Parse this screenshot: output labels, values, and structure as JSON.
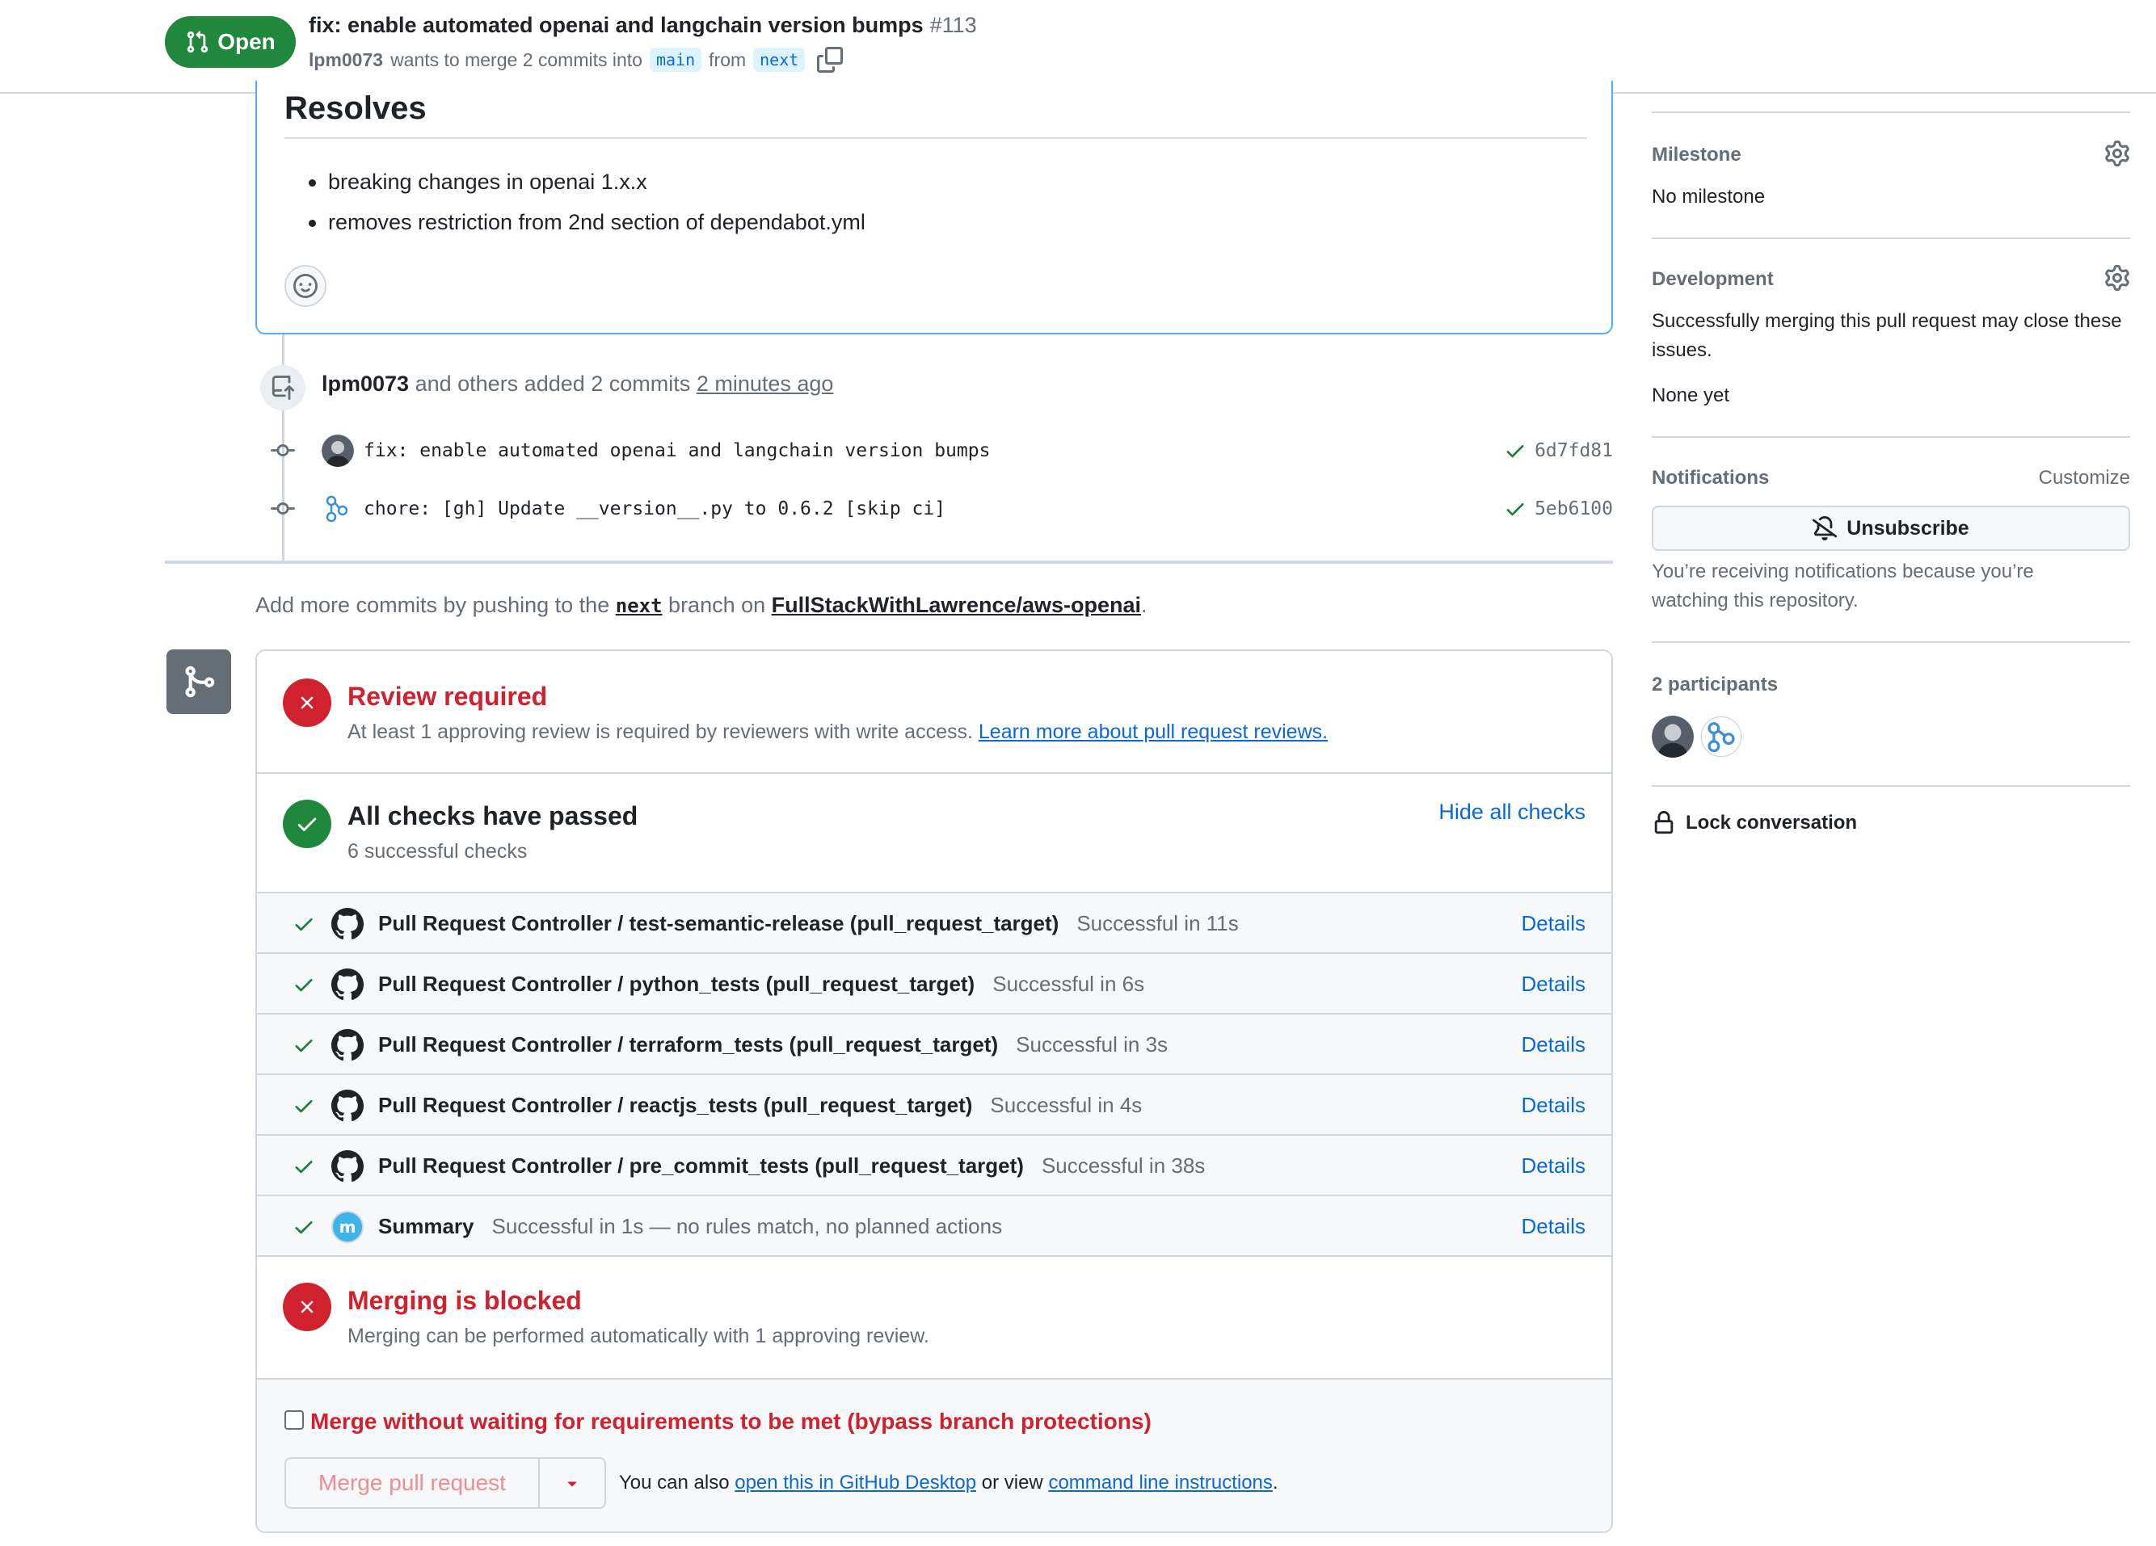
{
  "header": {
    "state": "Open",
    "title": "fix: enable automated openai and langchain version bumps",
    "number": "#113",
    "author": "lpm0073",
    "merge_text_1": "wants to merge 2 commits into",
    "base_branch": "main",
    "merge_text_2": "from",
    "head_branch": "next"
  },
  "description": {
    "heading": "Resolves",
    "items": [
      "breaking changes in openai 1.x.x",
      "removes restriction from 2nd section of dependabot.yml"
    ]
  },
  "timeline": {
    "author": "lpm0073",
    "summary": "and others added 2 commits",
    "time": "2 minutes ago",
    "commits": [
      {
        "message": "fix: enable automated openai and langchain version bumps",
        "sha": "6d7fd81"
      },
      {
        "message": "chore: [gh] Update __version__.py to 0.6.2 [skip ci]",
        "sha": "5eb6100"
      }
    ]
  },
  "push_hint": {
    "prefix": "Add more commits by pushing to the",
    "branch": "next",
    "middle": "branch on",
    "repo": "FullStackWithLawrence/aws-openai",
    "suffix": "."
  },
  "merge_box": {
    "review": {
      "title": "Review required",
      "text": "At least 1 approving review is required by reviewers with write access.",
      "link": "Learn more about pull request reviews."
    },
    "checks": {
      "title": "All checks have passed",
      "subtitle": "6 successful checks",
      "toggle": "Hide all checks",
      "details_label": "Details",
      "items": [
        {
          "name": "Pull Request Controller / test-semantic-release (pull_request_target)",
          "status": "Successful in 11s"
        },
        {
          "name": "Pull Request Controller / python_tests (pull_request_target)",
          "status": "Successful in 6s"
        },
        {
          "name": "Pull Request Controller / terraform_tests (pull_request_target)",
          "status": "Successful in 3s"
        },
        {
          "name": "Pull Request Controller / reactjs_tests (pull_request_target)",
          "status": "Successful in 4s"
        },
        {
          "name": "Pull Request Controller / pre_commit_tests (pull_request_target)",
          "status": "Successful in 38s"
        },
        {
          "name": "Summary",
          "status": "Successful in 1s — no rules match, no planned actions"
        }
      ]
    },
    "blocked": {
      "title": "Merging is blocked",
      "text": "Merging can be performed automatically with 1 approving review."
    },
    "bypass_label": "Merge without waiting for requirements to be met (bypass branch protections)",
    "merge_button": "Merge pull request",
    "hint_prefix": "You can also",
    "hint_link_1": "open this in GitHub Desktop",
    "hint_middle": "or view",
    "hint_link_2": "command line instructions",
    "hint_suffix": "."
  },
  "sidebar": {
    "milestone_heading": "Milestone",
    "milestone_value": "No milestone",
    "development_heading": "Development",
    "development_text": "Successfully merging this pull request may close these issues.",
    "development_value": "None yet",
    "notifications_heading": "Notifications",
    "customize": "Customize",
    "unsubscribe": "Unsubscribe",
    "notifications_reason": "You’re receiving notifications because you’re watching this repository.",
    "participants_heading": "2 participants",
    "lock": "Lock conversation"
  },
  "colors": {
    "open_green": "#1f883d",
    "danger_red": "#cf222e",
    "link_blue": "#0969da",
    "muted": "#656d76"
  }
}
